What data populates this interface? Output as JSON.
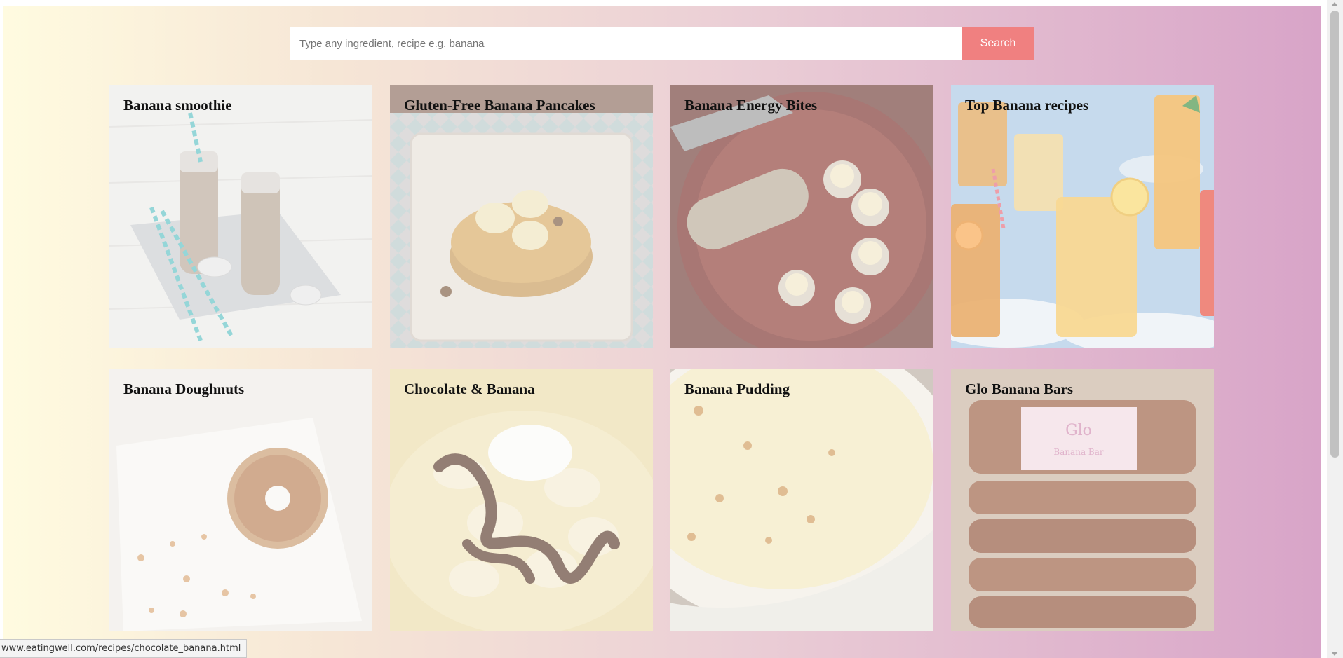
{
  "search": {
    "placeholder": "Type any ingredient, recipe e.g. banana",
    "button_label": "Search"
  },
  "recipes": [
    {
      "title": "Banana smoothie"
    },
    {
      "title": "Gluten-Free Banana Pancakes"
    },
    {
      "title": "Banana Energy Bites"
    },
    {
      "title": "Top Banana recipes"
    },
    {
      "title": "Banana Doughnuts"
    },
    {
      "title": "Chocolate & Banana"
    },
    {
      "title": "Banana Pudding"
    },
    {
      "title": "Glo Banana Bars"
    }
  ],
  "status_bar": {
    "url": "www.eatingwell.com/recipes/chocolate_banana.html"
  },
  "colors": {
    "background_gradient_start": "#fffbe0",
    "background_gradient_end": "#d8a4c8",
    "search_button": "#f08080"
  }
}
